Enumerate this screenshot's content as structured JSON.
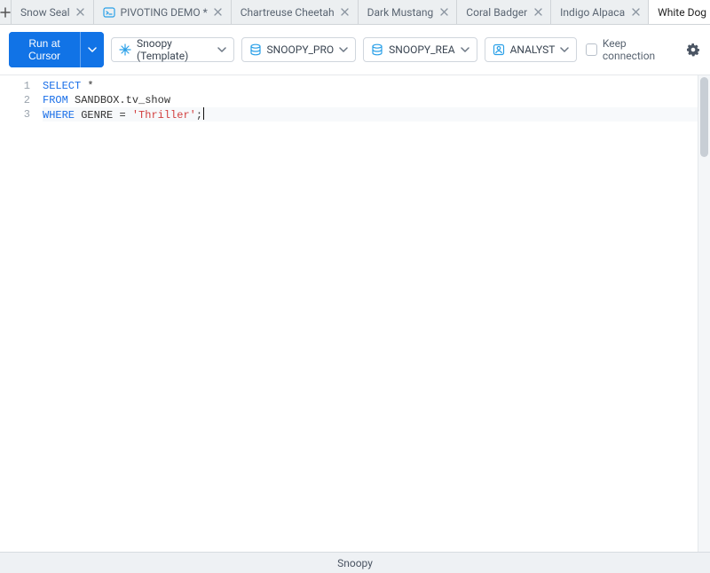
{
  "tabs": [
    {
      "label": "Snow Seal",
      "has_icon": false,
      "active": false
    },
    {
      "label": "PIVOTING DEMO *",
      "has_icon": true,
      "active": false
    },
    {
      "label": "Chartreuse Cheetah",
      "has_icon": false,
      "active": false
    },
    {
      "label": "Dark Mustang",
      "has_icon": false,
      "active": false
    },
    {
      "label": "Coral Badger",
      "has_icon": false,
      "active": false
    },
    {
      "label": "Indigo Alpaca",
      "has_icon": false,
      "active": false
    },
    {
      "label": "White Dog",
      "has_icon": false,
      "active": true
    }
  ],
  "toolbar": {
    "run_label": "Run at Cursor",
    "context_label": "Snoopy (Template)",
    "warehouse_label": "SNOOPY_PRO",
    "schema_label": "SNOOPY_REA",
    "role_label": "ANALYST",
    "keep_connection_label": "Keep connection"
  },
  "editor": {
    "lines": [
      {
        "n": "1",
        "tokens": [
          {
            "t": "SELECT",
            "c": "kw"
          },
          {
            "t": " ",
            "c": "ident"
          },
          {
            "t": "*",
            "c": "punct"
          }
        ]
      },
      {
        "n": "2",
        "tokens": [
          {
            "t": "FROM",
            "c": "kw"
          },
          {
            "t": " SANDBOX.tv_show",
            "c": "ident"
          }
        ]
      },
      {
        "n": "3",
        "tokens": [
          {
            "t": "WHERE",
            "c": "kw"
          },
          {
            "t": " GENRE ",
            "c": "ident"
          },
          {
            "t": "=",
            "c": "punct"
          },
          {
            "t": " ",
            "c": "ident"
          },
          {
            "t": "'Thriller'",
            "c": "str"
          },
          {
            "t": ";",
            "c": "punct"
          }
        ],
        "current": true,
        "caret_after": true
      }
    ]
  },
  "statusbar": {
    "label": "Snoopy"
  },
  "colors": {
    "accent": "#1173e6",
    "keyword": "#1a6fe8",
    "string": "#d23f3f"
  }
}
